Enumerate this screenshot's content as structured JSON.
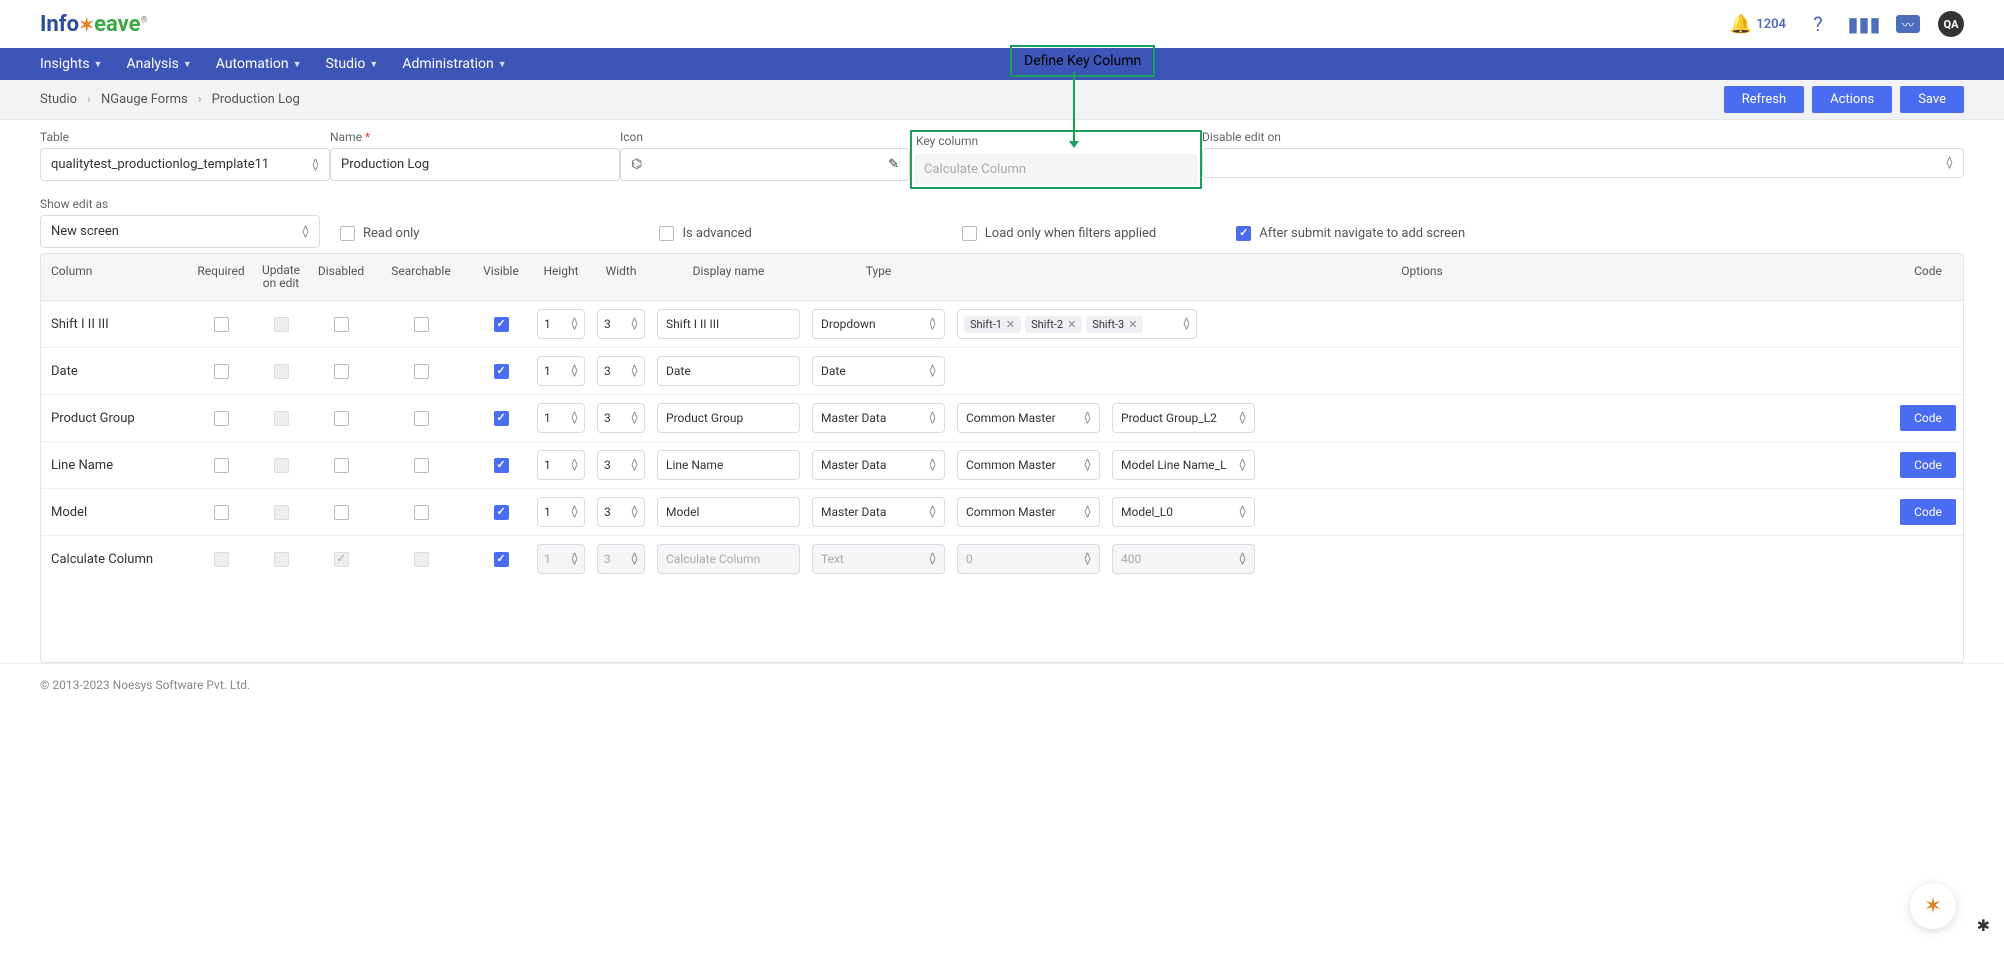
{
  "callout": "Define Key Column",
  "notif_count": "1204",
  "nav": [
    "Insights",
    "Analysis",
    "Automation",
    "Studio",
    "Administration"
  ],
  "crumbs": [
    "Studio",
    "NGauge Forms",
    "Production Log"
  ],
  "actions": {
    "refresh": "Refresh",
    "actions": "Actions",
    "save": "Save"
  },
  "fields": {
    "table_label": "Table",
    "table_value": "qualitytest_productionlog_template11",
    "name_label": "Name",
    "name_value": "Production Log",
    "icon_label": "Icon",
    "keycol_label": "Key column",
    "keycol_placeholder": "Calculate Column",
    "disable_label": "Disable edit on",
    "showedit_label": "Show edit as",
    "showedit_value": "New screen",
    "readonly": "Read only",
    "advanced": "Is advanced",
    "loadonly": "Load only when filters applied",
    "aftersubmit": "After submit navigate to add screen"
  },
  "cols": {
    "column": "Column",
    "required": "Required",
    "update": "Update on edit",
    "disabled": "Disabled",
    "searchable": "Searchable",
    "visible": "Visible",
    "height": "Height",
    "width": "Width",
    "display": "Display name",
    "type": "Type",
    "options": "Options",
    "code": "Code"
  },
  "rows": [
    {
      "name": "Shift I II III",
      "req": false,
      "upd": "gray",
      "dis": false,
      "sea": false,
      "vis": true,
      "h": "1",
      "w": "3",
      "disp": "Shift I II III",
      "type": "Dropdown",
      "opt1_chips": [
        "Shift-1",
        "Shift-2",
        "Shift-3"
      ],
      "opt2": "",
      "code": false,
      "disabledRow": false
    },
    {
      "name": "Date",
      "req": false,
      "upd": "gray",
      "dis": false,
      "sea": false,
      "vis": true,
      "h": "1",
      "w": "3",
      "disp": "Date",
      "type": "Date",
      "opt1": "",
      "opt2": "",
      "code": false,
      "disabledRow": false
    },
    {
      "name": "Product Group",
      "req": false,
      "upd": "gray",
      "dis": false,
      "sea": false,
      "vis": true,
      "h": "1",
      "w": "3",
      "disp": "Product Group",
      "type": "Master Data",
      "opt1": "Common Master",
      "opt2": "Product Group_L2",
      "code": true,
      "disabledRow": false
    },
    {
      "name": "Line Name",
      "req": false,
      "upd": "gray",
      "dis": false,
      "sea": false,
      "vis": true,
      "h": "1",
      "w": "3",
      "disp": "Line Name",
      "type": "Master Data",
      "opt1": "Common Master",
      "opt2": "Model Line Name_L",
      "code": true,
      "disabledRow": false
    },
    {
      "name": "Model",
      "req": false,
      "upd": "gray",
      "dis": false,
      "sea": false,
      "vis": true,
      "h": "1",
      "w": "3",
      "disp": "Model",
      "type": "Master Data",
      "opt1": "Common Master",
      "opt2": "Model_L0",
      "code": true,
      "disabledRow": false
    },
    {
      "name": "Calculate Column",
      "req": "gray",
      "upd": "gray",
      "dis": "gray-checked",
      "sea": "gray",
      "vis": true,
      "h": "1",
      "w": "3",
      "disp": "Calculate Column",
      "type": "Text",
      "opt1": "0",
      "opt2": "400",
      "code": false,
      "disabledRow": true
    }
  ],
  "code_label": "Code",
  "footer": "© 2013-2023 Noesys Software Pvt. Ltd."
}
